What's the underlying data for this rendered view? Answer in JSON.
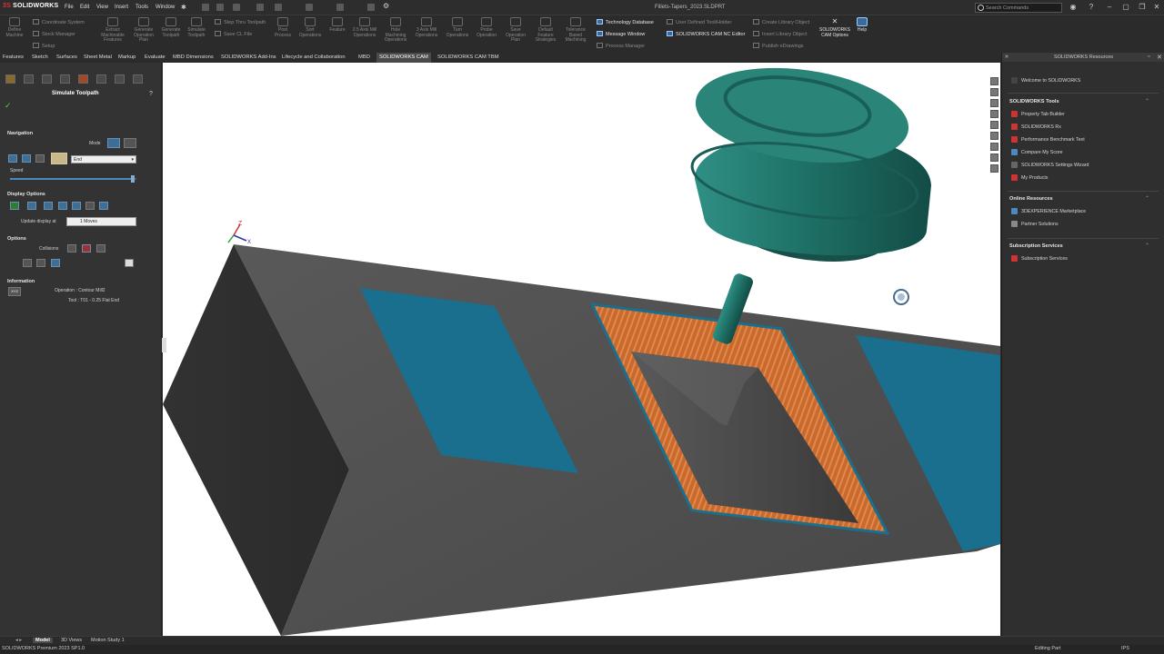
{
  "app": {
    "logo_prefix": "3S",
    "logo": "SOLIDWORKS",
    "doc_title": "Fillets-Tapers_2023.SLDPRT"
  },
  "menu": [
    "File",
    "Edit",
    "View",
    "Insert",
    "Tools",
    "Window"
  ],
  "search": {
    "placeholder": "Search Commands"
  },
  "commands": {
    "define_machine": "Define Machine",
    "coordinate_system": "Coordinate System",
    "stock_manager": "Stock Manager",
    "setup": "Setup",
    "extract_features": "Extract Machinable Features",
    "generate_plan": "Generate Operation Plan",
    "generate_toolpath": "Generate Toolpath",
    "simulate_toolpath": "Simulate Toolpath",
    "step_thru": "Step Thru Toolpath",
    "save_cl": "Save CL File",
    "post_process": "Post Process",
    "sort_ops": "Sort Operations",
    "feature": "Feature",
    "mill_25": "2.5 Axis Mill Operations",
    "hole_ops": "Hole Machining Operations",
    "mill_3": "3 Axis Mill Operations",
    "turn_ops": "Turn Operations",
    "probe": "Probe Operation",
    "save_plan": "Save Operation Plan",
    "default_strat": "Default Feature Strategies",
    "tolerance": "Tolerance Based Machining",
    "tech_db": "Technology Database",
    "message_window": "Message Window",
    "process_manager": "Process Manager",
    "user_tool": "User Defined Tool/Holder",
    "nc_editor": "SOLIDWORKS CAM NC Editor",
    "create_lib": "Create Library Object",
    "insert_lib": "Insert Library Object",
    "publish": "Publish eDrawings",
    "cam_options": "SOLIDWORKS CAM Options",
    "help": "Help"
  },
  "tabs": [
    "Features",
    "Sketch",
    "Surfaces",
    "Sheet Metal",
    "Markup",
    "Evaluate",
    "MBD Dimensions",
    "SOLIDWORKS Add-Ins",
    "Lifecycle and Collaboration",
    "MBD",
    "SOLIDWORKS CAM",
    "SOLIDWORKS CAM TBM"
  ],
  "left_panel": {
    "title": "Simulate Toolpath",
    "navigation": "Navigation",
    "mode_label": "Mode",
    "end_select": "End",
    "speed_label": "Speed",
    "display_options": "Display Options",
    "update_label": "Update display at",
    "update_value": "1 Moves",
    "options": "Options",
    "collisions": "Collisions",
    "information": "Information",
    "xyz": "XYZ",
    "operation": "Operation : Contour Mill2",
    "tool": "Tool : T01 - 0.25 Flat End",
    "speed_fraction": 0.97
  },
  "viewport": {
    "axis_x": "X",
    "axis_z": "Z"
  },
  "right_panel": {
    "header": "SOLIDWORKS Resources",
    "welcome": "Welcome to SOLIDWORKS",
    "tools_title": "SOLIDWORKS Tools",
    "tools": [
      "Property Tab Builder",
      "SOLIDWORKS Rx",
      "Performance Benchmark Test",
      "Compare My Score",
      "SOLIDWORKS Settings Wizard",
      "My Products"
    ],
    "online_title": "Online Resources",
    "online": [
      "3DEXPERIENCE Marketplace",
      "Partner Solutions"
    ],
    "sub_title": "Subscription Services",
    "sub": [
      "Subscription Services"
    ]
  },
  "bottom_tabs": [
    "Model",
    "3D Views",
    "Motion Study 1"
  ],
  "status": {
    "left": "SOLIDWORKS Premium 2023 SP1.0",
    "right": "Editing Part",
    "units": "IPS"
  },
  "colors": {
    "tool": "#1d6e64",
    "toolpath": "#e07a3c",
    "feature_blue": "#1a6e8e",
    "part": "#4b4b4b"
  }
}
